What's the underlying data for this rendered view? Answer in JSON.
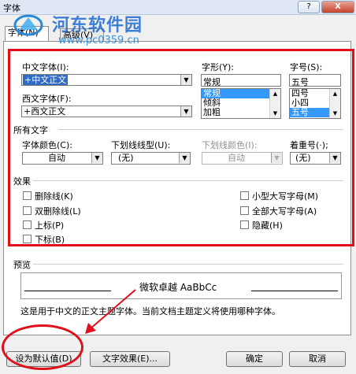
{
  "window": {
    "title": "字体",
    "help_label": "?",
    "close_label": "X"
  },
  "watermark": {
    "text": "河东软件园",
    "url": "www.pc0359.cn"
  },
  "tabs": [
    {
      "label": "字体(N)"
    },
    {
      "label": "高级(V)"
    }
  ],
  "font": {
    "chinese_label": "中文字体(I):",
    "chinese_value": "+中文正文",
    "western_label": "西文字体(F):",
    "western_value": "+西文正文",
    "style_label": "字形(Y):",
    "style_value": "常规",
    "style_options": [
      "常规",
      "倾斜",
      "加粗"
    ],
    "size_label": "字号(S):",
    "size_value": "五号",
    "size_options": [
      "四号",
      "小四",
      "五号"
    ]
  },
  "all_text": {
    "section_label": "所有文字",
    "color_label": "字体颜色(C):",
    "color_value": "自动",
    "underline_label": "下划线线型(U):",
    "underline_value": "(无)",
    "underline_color_label": "下划线颜色(I):",
    "underline_color_value": "自动",
    "emphasis_label": "着重号(·);",
    "emphasis_value": "(无)"
  },
  "effects": {
    "section_label": "效果",
    "left": [
      "删除线(K)",
      "双删除线(L)",
      "上标(P)",
      "下标(B)"
    ],
    "right": [
      "小型大写字母(M)",
      "全部大写字母(A)",
      "隐藏(H)"
    ]
  },
  "preview": {
    "section_label": "预览",
    "sample_text": "微软卓越 AaBbCc",
    "description": "这是用于中文的正文主题字体。当前文档主题定义将使用哪种字体。"
  },
  "buttons": {
    "default": "设为默认值(D)",
    "text_effects": "文字效果(E)...",
    "ok": "确定",
    "cancel": "取消"
  },
  "colors": {
    "highlight": "#e0101a",
    "selection": "#3399ff"
  }
}
